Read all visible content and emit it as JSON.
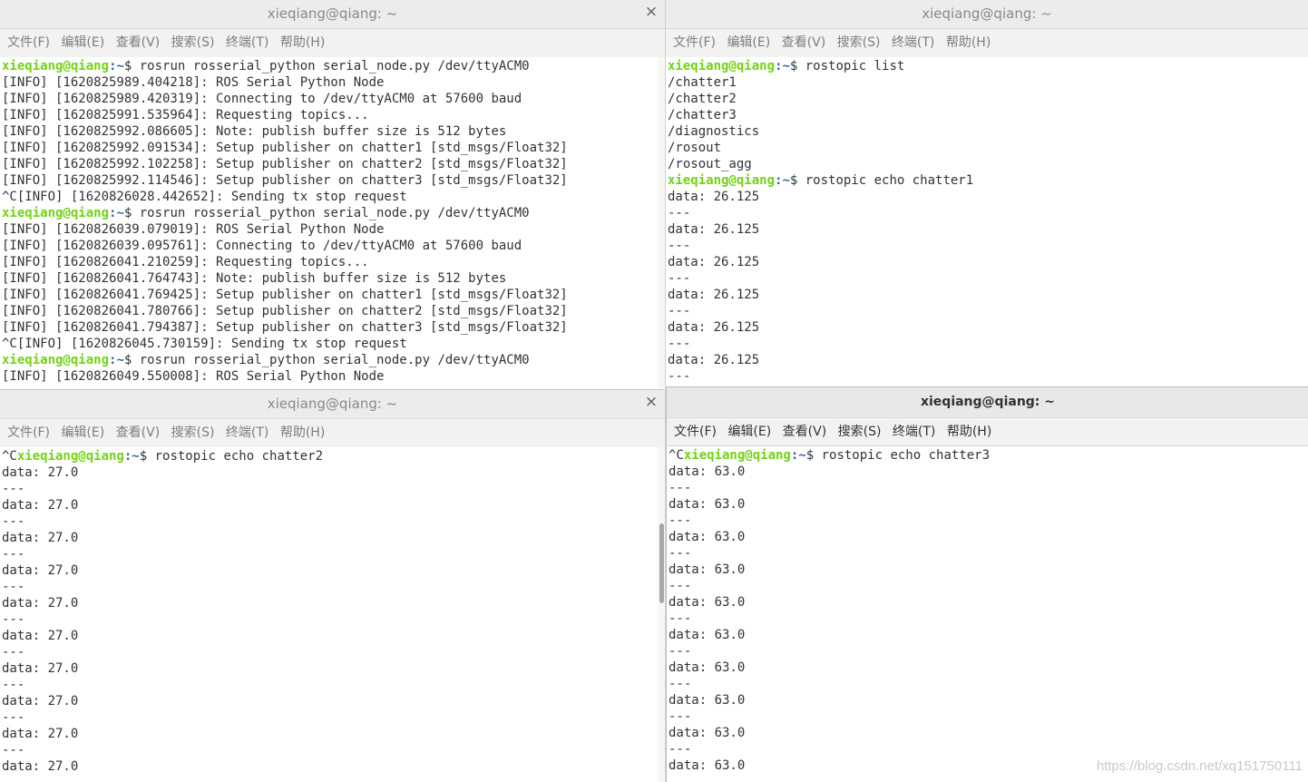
{
  "menu": [
    "文件(F)",
    "编辑(E)",
    "查看(V)",
    "搜索(S)",
    "终端(T)",
    "帮助(H)"
  ],
  "windows": {
    "tl": {
      "title": "xieqiang@qiang: ~",
      "lines": [
        {
          "user": "xieqiang@qiang",
          "path": ":~",
          "cmd": "$ rosrun rosserial_python serial_node.py /dev/ttyACM0"
        },
        {
          "text": "[INFO] [1620825989.404218]: ROS Serial Python Node"
        },
        {
          "text": "[INFO] [1620825989.420319]: Connecting to /dev/ttyACM0 at 57600 baud"
        },
        {
          "text": "[INFO] [1620825991.535964]: Requesting topics..."
        },
        {
          "text": "[INFO] [1620825992.086605]: Note: publish buffer size is 512 bytes"
        },
        {
          "text": "[INFO] [1620825992.091534]: Setup publisher on chatter1 [std_msgs/Float32]"
        },
        {
          "text": "[INFO] [1620825992.102258]: Setup publisher on chatter2 [std_msgs/Float32]"
        },
        {
          "text": "[INFO] [1620825992.114546]: Setup publisher on chatter3 [std_msgs/Float32]"
        },
        {
          "text": "^C[INFO] [1620826028.442652]: Sending tx stop request"
        },
        {
          "user": "xieqiang@qiang",
          "path": ":~",
          "cmd": "$ rosrun rosserial_python serial_node.py /dev/ttyACM0"
        },
        {
          "text": "[INFO] [1620826039.079019]: ROS Serial Python Node"
        },
        {
          "text": "[INFO] [1620826039.095761]: Connecting to /dev/ttyACM0 at 57600 baud"
        },
        {
          "text": "[INFO] [1620826041.210259]: Requesting topics..."
        },
        {
          "text": "[INFO] [1620826041.764743]: Note: publish buffer size is 512 bytes"
        },
        {
          "text": "[INFO] [1620826041.769425]: Setup publisher on chatter1 [std_msgs/Float32]"
        },
        {
          "text": "[INFO] [1620826041.780766]: Setup publisher on chatter2 [std_msgs/Float32]"
        },
        {
          "text": "[INFO] [1620826041.794387]: Setup publisher on chatter3 [std_msgs/Float32]"
        },
        {
          "text": "^C[INFO] [1620826045.730159]: Sending tx stop request"
        },
        {
          "user": "xieqiang@qiang",
          "path": ":~",
          "cmd": "$ rosrun rosserial_python serial_node.py /dev/ttyACM0"
        },
        {
          "text": "[INFO] [1620826049.550008]: ROS Serial Python Node"
        }
      ]
    },
    "tr": {
      "title": "xieqiang@qiang: ~",
      "lines": [
        {
          "user": "xieqiang@qiang",
          "path": ":~",
          "cmd": "$ rostopic list"
        },
        {
          "text": "/chatter1"
        },
        {
          "text": "/chatter2"
        },
        {
          "text": "/chatter3"
        },
        {
          "text": "/diagnostics"
        },
        {
          "text": "/rosout"
        },
        {
          "text": "/rosout_agg"
        },
        {
          "user": "xieqiang@qiang",
          "path": ":~",
          "cmd": "$ rostopic echo chatter1"
        },
        {
          "text": "data: 26.125"
        },
        {
          "text": "---"
        },
        {
          "text": "data: 26.125"
        },
        {
          "text": "---"
        },
        {
          "text": "data: 26.125"
        },
        {
          "text": "---"
        },
        {
          "text": "data: 26.125"
        },
        {
          "text": "---"
        },
        {
          "text": "data: 26.125"
        },
        {
          "text": "---"
        },
        {
          "text": "data: 26.125"
        },
        {
          "text": "---"
        }
      ]
    },
    "bl": {
      "title": "xieqiang@qiang: ~",
      "lines": [
        {
          "pre": "^C",
          "user": "xieqiang@qiang",
          "path": ":~",
          "cmd": "$ rostopic echo chatter2"
        },
        {
          "text": "data: 27.0"
        },
        {
          "text": "---"
        },
        {
          "text": "data: 27.0"
        },
        {
          "text": "---"
        },
        {
          "text": "data: 27.0"
        },
        {
          "text": "---"
        },
        {
          "text": "data: 27.0"
        },
        {
          "text": "---"
        },
        {
          "text": "data: 27.0"
        },
        {
          "text": "---"
        },
        {
          "text": "data: 27.0"
        },
        {
          "text": "---"
        },
        {
          "text": "data: 27.0"
        },
        {
          "text": "---"
        },
        {
          "text": "data: 27.0"
        },
        {
          "text": "---"
        },
        {
          "text": "data: 27.0"
        },
        {
          "text": "---"
        },
        {
          "text": "data: 27.0"
        }
      ]
    },
    "br": {
      "title": "xieqiang@qiang: ~",
      "lines": [
        {
          "pre": "^C",
          "user": "xieqiang@qiang",
          "path": ":~",
          "cmd": "$ rostopic echo chatter3"
        },
        {
          "text": "data: 63.0"
        },
        {
          "text": "---"
        },
        {
          "text": "data: 63.0"
        },
        {
          "text": "---"
        },
        {
          "text": "data: 63.0"
        },
        {
          "text": "---"
        },
        {
          "text": "data: 63.0"
        },
        {
          "text": "---"
        },
        {
          "text": "data: 63.0"
        },
        {
          "text": "---"
        },
        {
          "text": "data: 63.0"
        },
        {
          "text": "---"
        },
        {
          "text": "data: 63.0"
        },
        {
          "text": "---"
        },
        {
          "text": "data: 63.0"
        },
        {
          "text": "---"
        },
        {
          "text": "data: 63.0"
        },
        {
          "text": "---"
        },
        {
          "text": "data: 63.0"
        }
      ]
    }
  },
  "watermark": "https://blog.csdn.net/xq151750111"
}
